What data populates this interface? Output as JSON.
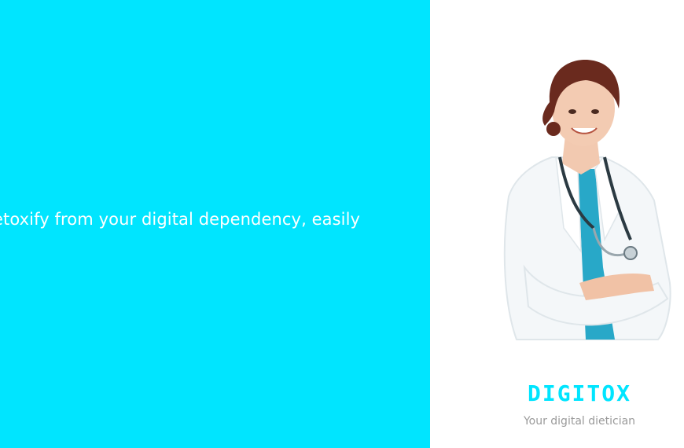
{
  "hero": {
    "tagline": "etoxify from your digital dependency, easily"
  },
  "side": {
    "photo_icon": "doctor-portrait-illustration",
    "brand_name": "DIGITOX",
    "brand_subtitle": "Your digital dietician"
  },
  "colors": {
    "accent": "#00e5ff",
    "subtitle_text": "#9a9a9a",
    "tagline_text": "#ffffff"
  }
}
